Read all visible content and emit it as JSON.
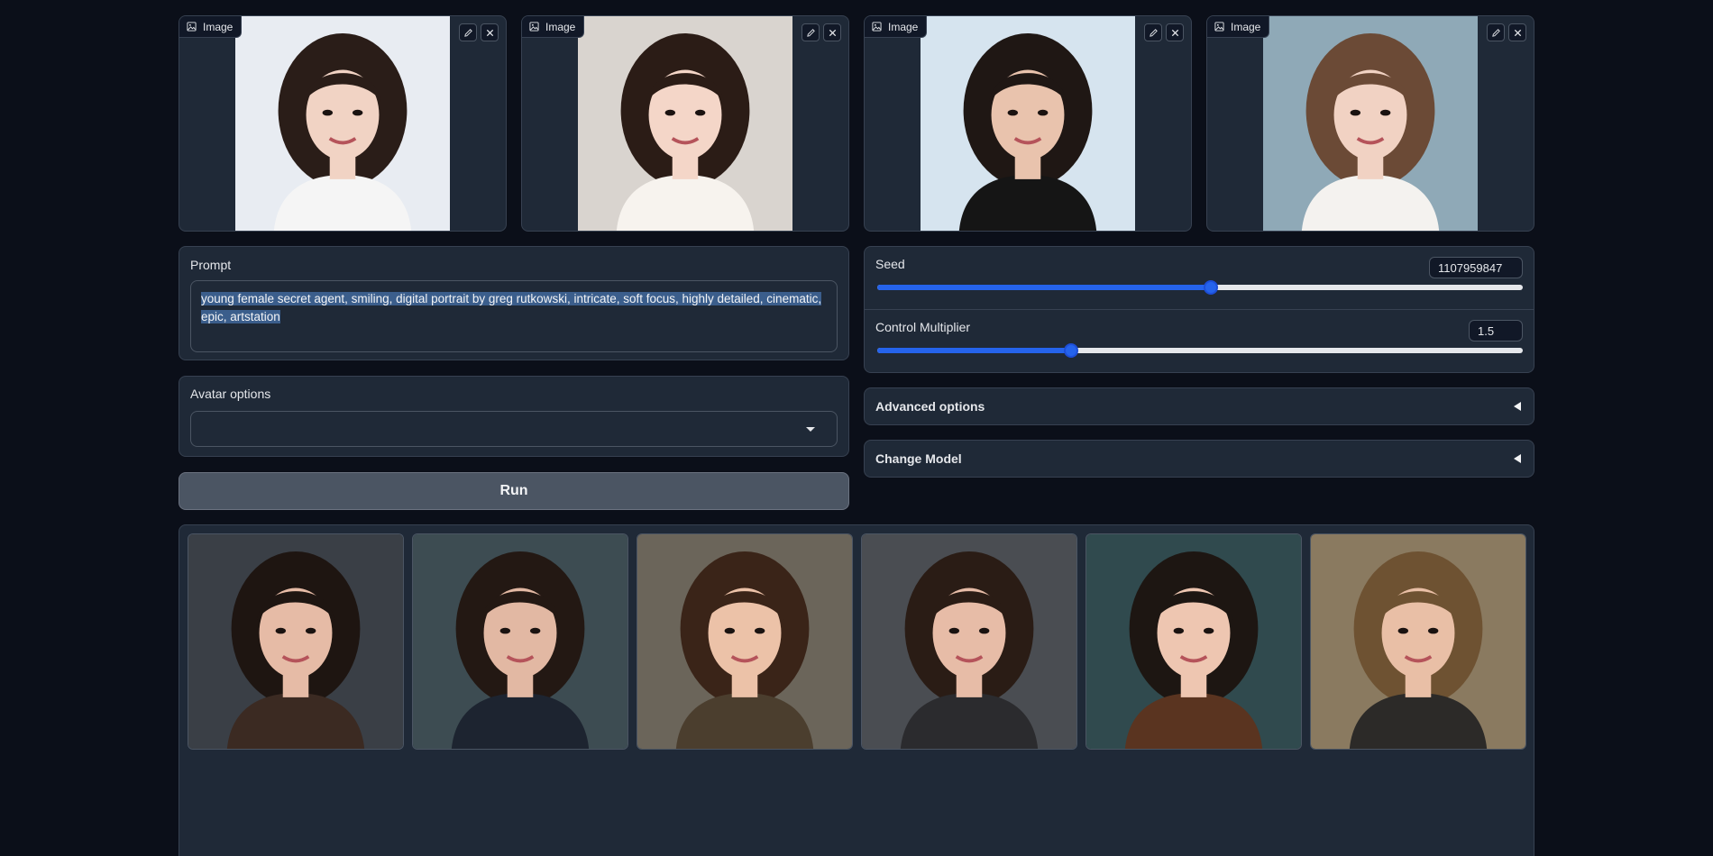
{
  "input_images": [
    {
      "label": "Image",
      "bg": "#e8ecf2",
      "skin": "#f1d3c4",
      "hair": "#2a1d18",
      "top": "#f5f5f5"
    },
    {
      "label": "Image",
      "bg": "#d9d4cf",
      "skin": "#f4d6c8",
      "hair": "#2b1c16",
      "top": "#f7f3ee"
    },
    {
      "label": "Image",
      "bg": "#d6e4ef",
      "skin": "#e9c3ad",
      "hair": "#1f1714",
      "top": "#151515"
    },
    {
      "label": "Image",
      "bg": "#8fa9b7",
      "skin": "#f1d2c3",
      "hair": "#6b4a36",
      "top": "#f4f2ef"
    }
  ],
  "prompt": {
    "label": "Prompt",
    "line1": "young female secret agent, smiling, digital portrait by greg rutkowski, intricate, soft focus, highly detailed, cinematic,",
    "line2": "epic, artstation"
  },
  "avatar_options": {
    "label": "Avatar options",
    "value": ""
  },
  "run": {
    "label": "Run"
  },
  "seed": {
    "label": "Seed",
    "value": "1107959847",
    "fraction": 0.517
  },
  "control_multiplier": {
    "label": "Control Multiplier",
    "value": "1.5",
    "fraction": 0.3
  },
  "advanced_options": {
    "label": "Advanced options"
  },
  "change_model": {
    "label": "Change Model"
  },
  "gallery": [
    {
      "bg": "#3a3f46",
      "skin": "#e6bba6",
      "hair": "#1e1511",
      "top": "#3b2a22"
    },
    {
      "bg": "#3d4c52",
      "skin": "#e2b8a3",
      "hair": "#231813",
      "top": "#1d2430"
    },
    {
      "bg": "#6b655a",
      "skin": "#ecc2a8",
      "hair": "#3a2418",
      "top": "#4b3e2e"
    },
    {
      "bg": "#4a4d52",
      "skin": "#e7bca7",
      "hair": "#2a1c15",
      "top": "#2b2b2e"
    },
    {
      "bg": "#304a4e",
      "skin": "#eec6b1",
      "hair": "#1d1612",
      "top": "#5a3420"
    },
    {
      "bg": "#8a7a60",
      "skin": "#e9bfa6",
      "hair": "#6e5232",
      "top": "#2c2a28"
    }
  ],
  "colors": {
    "page_bg": "#0b0f19",
    "panel_bg": "#1f2937",
    "accent": "#2563eb"
  }
}
